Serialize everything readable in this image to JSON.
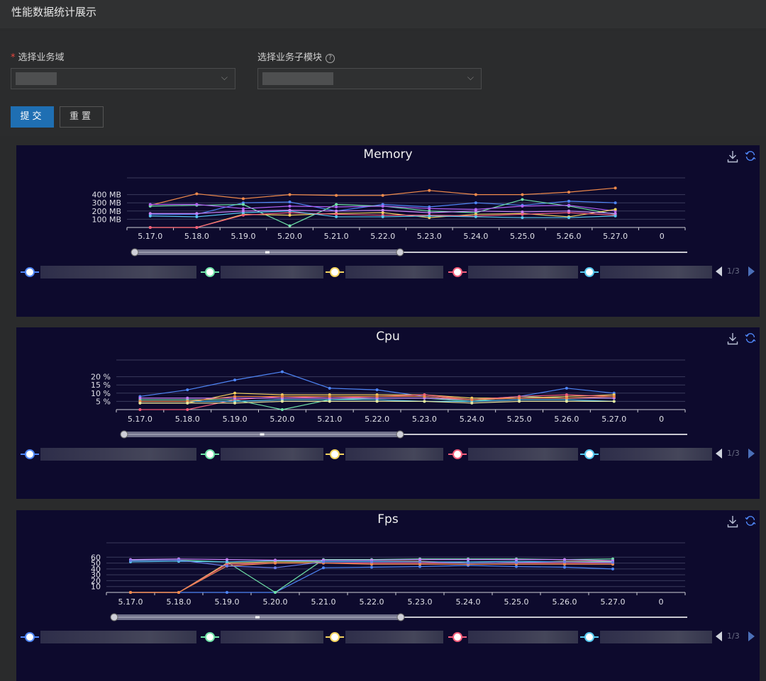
{
  "page_title": "性能数据统计展示",
  "form": {
    "domain_label": "选择业务域",
    "required_mark": "*",
    "module_label": "选择业务子模块",
    "help_icon": "?",
    "chevron": "⌵"
  },
  "buttons": {
    "submit": "提交",
    "reset": "重置"
  },
  "icons": {
    "download": "download-icon",
    "restore": "restore-icon"
  },
  "legend_colors": [
    "#4f86f7",
    "#6fe3a8",
    "#f4d35e",
    "#f25c7a",
    "#56c9f0"
  ],
  "pager_text": "1/3",
  "chart_data": [
    {
      "type": "line",
      "title": "Memory",
      "categories": [
        "5.17.0",
        "5.18.0",
        "5.19.0",
        "5.20.0",
        "5.21.0",
        "5.22.0",
        "5.23.0",
        "5.24.0",
        "5.25.0",
        "5.26.0",
        "5.27.0",
        "0"
      ],
      "yticks": [
        "100 MB",
        "200 MB",
        "300 MB",
        "400 MB"
      ],
      "ylim": [
        0,
        500
      ],
      "datazoom": [
        0,
        0.48
      ],
      "series": [
        {
          "color": "#f08a4b",
          "values": [
            270,
            410,
            350,
            400,
            390,
            390,
            450,
            400,
            400,
            430,
            480,
            null
          ]
        },
        {
          "color": "#4f86f7",
          "values": [
            160,
            160,
            300,
            310,
            200,
            280,
            250,
            300,
            270,
            320,
            300,
            null
          ]
        },
        {
          "color": "#6fe3a8",
          "values": [
            260,
            270,
            280,
            20,
            280,
            260,
            200,
            180,
            340,
            260,
            160,
            null
          ]
        },
        {
          "color": "#b362f5",
          "values": [
            280,
            280,
            230,
            260,
            250,
            260,
            230,
            220,
            260,
            270,
            200,
            null
          ]
        },
        {
          "color": "#f4d35e",
          "values": [
            0,
            0,
            160,
            150,
            170,
            180,
            120,
            160,
            170,
            130,
            220,
            null
          ]
        },
        {
          "color": "#f25c7a",
          "values": [
            0,
            0,
            150,
            180,
            160,
            150,
            150,
            140,
            160,
            180,
            150,
            null
          ]
        },
        {
          "color": "#56c9f0",
          "values": [
            140,
            130,
            180,
            200,
            130,
            130,
            140,
            130,
            120,
            120,
            140,
            null
          ]
        },
        {
          "color": "#c780f5",
          "values": [
            170,
            170,
            200,
            210,
            200,
            210,
            180,
            200,
            190,
            200,
            170,
            null
          ]
        }
      ]
    },
    {
      "type": "line",
      "title": "Cpu",
      "categories": [
        "5.17.0",
        "5.18.0",
        "5.19.0",
        "5.20.0",
        "5.21.0",
        "5.22.0",
        "5.23.0",
        "5.24.0",
        "5.25.0",
        "5.26.0",
        "5.27.0",
        "0"
      ],
      "yticks": [
        "5 %",
        "10 %",
        "15 %",
        "20 %"
      ],
      "ylim": [
        0,
        25
      ],
      "datazoom": [
        0,
        0.49
      ],
      "series": [
        {
          "color": "#4f86f7",
          "values": [
            8,
            12,
            18,
            23,
            13,
            12,
            8,
            6,
            8,
            13,
            10,
            null
          ]
        },
        {
          "color": "#6fe3a8",
          "values": [
            6,
            6,
            6,
            0,
            6,
            7,
            7,
            5,
            8,
            7,
            7,
            null
          ]
        },
        {
          "color": "#f4d35e",
          "values": [
            4,
            4,
            10,
            9,
            9,
            9,
            9,
            7,
            7,
            8,
            9,
            null
          ]
        },
        {
          "color": "#f25c7a",
          "values": [
            0,
            0,
            6,
            8,
            7,
            8,
            9,
            6,
            8,
            9,
            8,
            null
          ]
        },
        {
          "color": "#56c9f0",
          "values": [
            5,
            5,
            5,
            6,
            6,
            6,
            5,
            5,
            6,
            6,
            5,
            null
          ]
        },
        {
          "color": "#c780f5",
          "values": [
            7,
            7,
            7,
            7,
            7,
            7,
            7,
            6,
            7,
            7,
            7,
            null
          ]
        },
        {
          "color": "#f08a4b",
          "values": [
            5,
            5,
            8,
            8,
            8,
            8,
            8,
            6,
            7,
            7,
            8,
            null
          ]
        },
        {
          "color": "#e6e8a0",
          "values": [
            4,
            4,
            4,
            5,
            5,
            5,
            5,
            4,
            5,
            5,
            5,
            null
          ]
        }
      ]
    },
    {
      "type": "line",
      "title": "Fps",
      "categories": [
        "5.17.0",
        "5.18.0",
        "5.19.0",
        "5.20.0",
        "5.21.0",
        "5.22.0",
        "5.23.0",
        "5.24.0",
        "5.25.0",
        "5.26.0",
        "5.27.0",
        "0"
      ],
      "yticks": [
        "10",
        "20",
        "30",
        "40",
        "50",
        "60"
      ],
      "ylim": [
        0,
        70
      ],
      "datazoom": [
        0,
        0.5
      ],
      "series": [
        {
          "color": "#4f86f7",
          "values": [
            0,
            0,
            0,
            0,
            42,
            43,
            44,
            46,
            44,
            43,
            40,
            null
          ]
        },
        {
          "color": "#6fe3a8",
          "values": [
            55,
            55,
            52,
            0,
            56,
            56,
            57,
            57,
            57,
            56,
            57,
            null
          ]
        },
        {
          "color": "#f4d35e",
          "values": [
            0,
            0,
            50,
            52,
            52,
            53,
            53,
            50,
            51,
            53,
            53,
            null
          ]
        },
        {
          "color": "#f25c7a",
          "values": [
            0,
            0,
            48,
            50,
            50,
            50,
            50,
            50,
            50,
            50,
            50,
            null
          ]
        },
        {
          "color": "#56c9f0",
          "values": [
            52,
            53,
            52,
            54,
            53,
            53,
            52,
            52,
            53,
            52,
            52,
            null
          ]
        },
        {
          "color": "#c780f5",
          "values": [
            56,
            57,
            56,
            55,
            55,
            55,
            56,
            56,
            56,
            56,
            54,
            null
          ]
        },
        {
          "color": "#f08a4b",
          "values": [
            0,
            0,
            45,
            50,
            50,
            48,
            48,
            48,
            48,
            48,
            48,
            null
          ]
        },
        {
          "color": "#6a7ee8",
          "values": [
            54,
            55,
            45,
            42,
            52,
            52,
            52,
            50,
            51,
            52,
            51,
            null
          ]
        }
      ]
    }
  ]
}
